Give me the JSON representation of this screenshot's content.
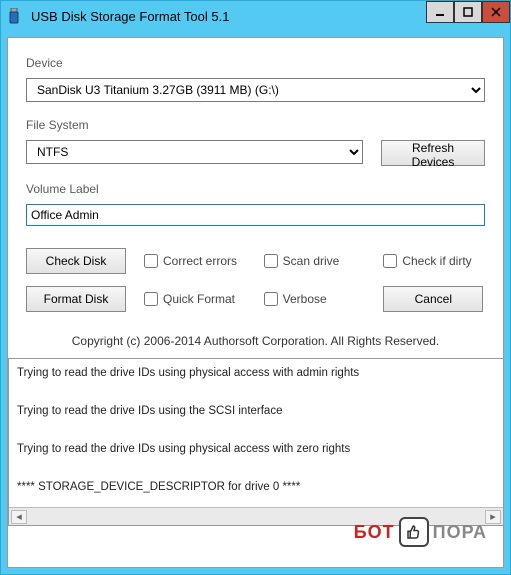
{
  "titlebar": {
    "title": "USB Disk Storage Format Tool 5.1"
  },
  "labels": {
    "device": "Device",
    "filesystem": "File System",
    "volumelabel": "Volume Label"
  },
  "device": {
    "selected": "SanDisk U3 Titanium 3.27GB (3911 MB)  (G:\\)"
  },
  "filesystem": {
    "selected": "NTFS"
  },
  "buttons": {
    "refresh": "Refresh Devices",
    "checkdisk": "Check Disk",
    "formatdisk": "Format Disk",
    "cancel": "Cancel"
  },
  "volumelabel": {
    "value": "Office Admin"
  },
  "checks": {
    "correct_errors": "Correct errors",
    "scan_drive": "Scan drive",
    "check_if_dirty": "Check if dirty",
    "quick_format": "Quick Format",
    "verbose": "Verbose"
  },
  "copyright": "Copyright (c) 2006-2014 Authorsoft Corporation. All Rights Reserved.",
  "log": {
    "lines": [
      "Trying to read the drive IDs using physical access with admin rights",
      "Trying to read the drive IDs using the SCSI interface",
      "Trying to read the drive IDs using physical access with zero rights",
      "**** STORAGE_DEVICE_DESCRIPTOR for drive 0 ****"
    ]
  },
  "watermark": {
    "part1": "БОТ",
    "part2": "ПОРА"
  }
}
